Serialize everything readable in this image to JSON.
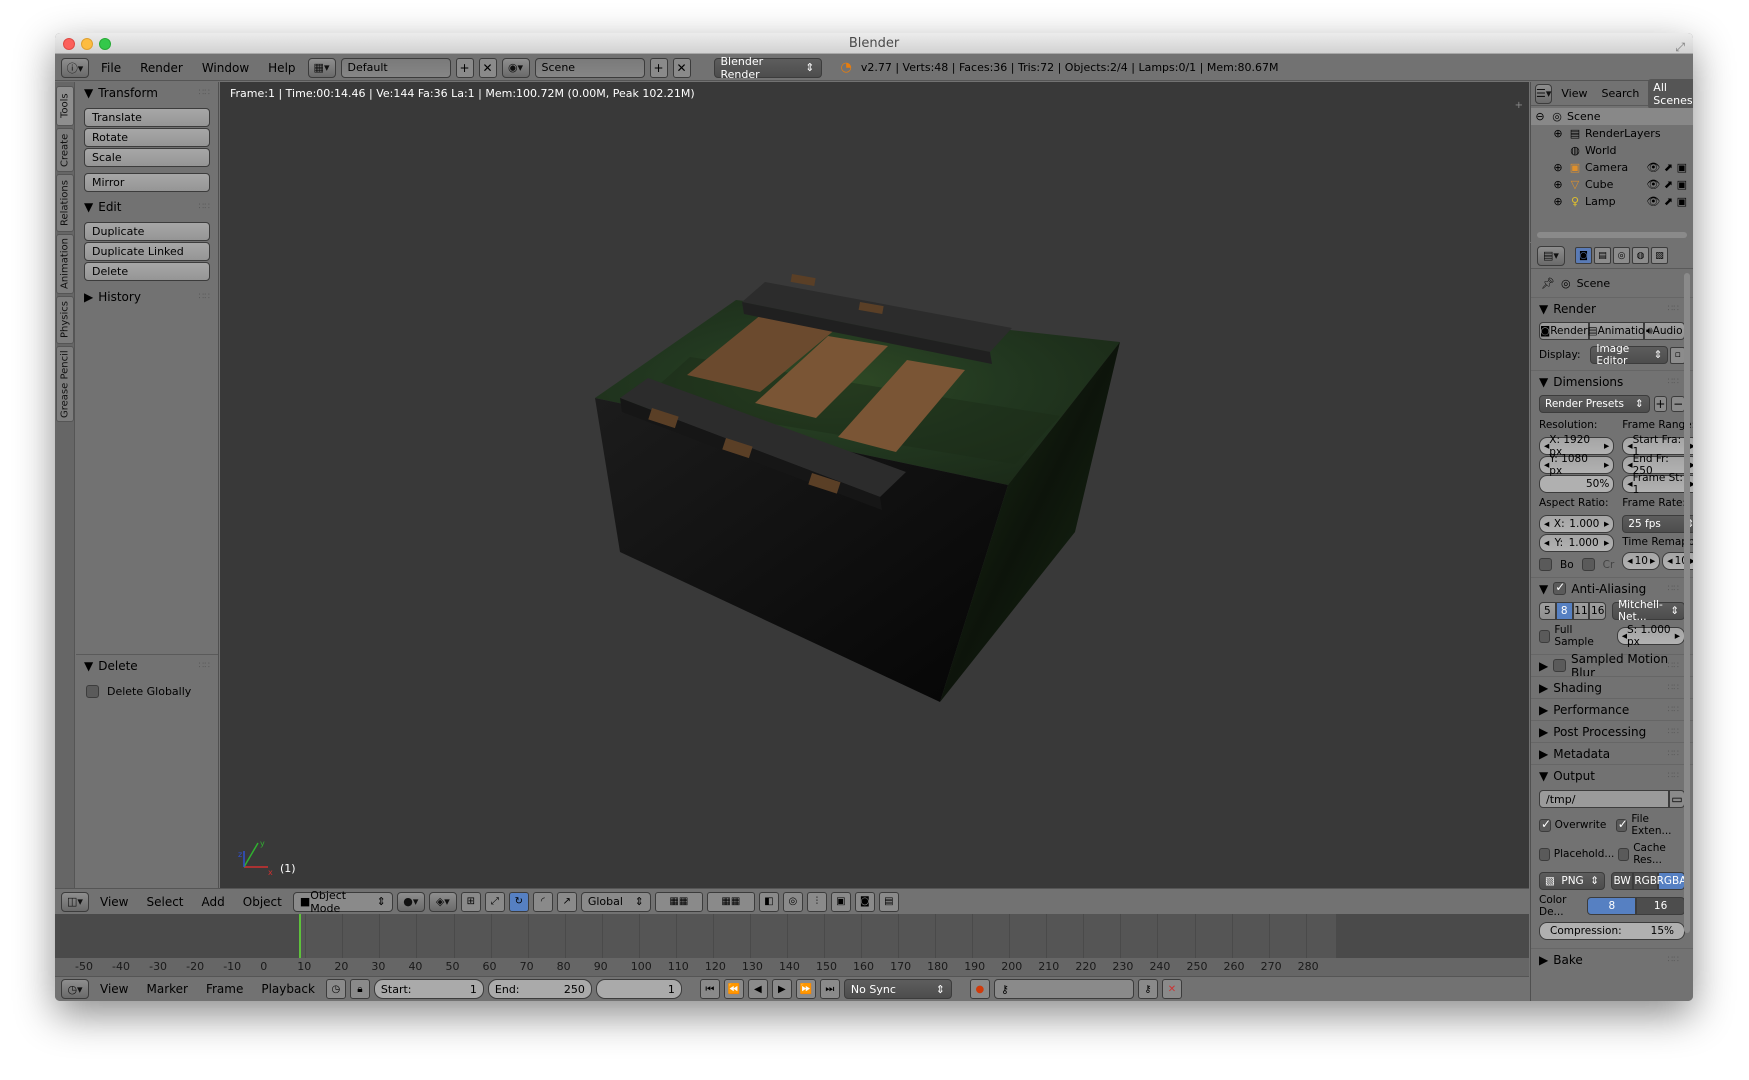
{
  "window": {
    "title": "Blender"
  },
  "infobar": {
    "menus": [
      "File",
      "Render",
      "Window",
      "Help"
    ],
    "layout": "Default",
    "scene": "Scene",
    "engine": "Blender Render",
    "stats": "v2.77 | Verts:48 | Faces:36 | Tris:72 | Objects:2/4 | Lamps:0/1 | Mem:80.67M"
  },
  "tabs": [
    "Tools",
    "Create",
    "Relations",
    "Animation",
    "Physics",
    "Grease Pencil"
  ],
  "toolshelf": {
    "transform": {
      "title": "Transform",
      "buttons": [
        "Translate",
        "Rotate",
        "Scale"
      ]
    },
    "mirror": "Mirror",
    "edit": {
      "title": "Edit",
      "buttons": [
        "Duplicate",
        "Duplicate Linked",
        "Delete"
      ]
    },
    "history": "History",
    "operator": {
      "title": "Delete",
      "option": "Delete Globally"
    }
  },
  "viewport": {
    "info": "Frame:1 | Time:00:14.46 | Ve:144 Fa:36 La:1 | Mem:100.72M (0.00M, Peak 102.21M)",
    "object_label": "(1)"
  },
  "view3d_header": {
    "menus": [
      "View",
      "Select",
      "Add",
      "Object"
    ],
    "mode": "Object Mode",
    "orientation": "Global"
  },
  "timeline": {
    "ticks": [
      "-50",
      "-40",
      "-30",
      "-20",
      "-10",
      "0",
      "10",
      "20",
      "30",
      "40",
      "50",
      "60",
      "70",
      "80",
      "90",
      "100",
      "110",
      "120",
      "130",
      "140",
      "150",
      "160",
      "170",
      "180",
      "190",
      "200",
      "210",
      "220",
      "230",
      "240",
      "250",
      "260",
      "270",
      "280"
    ],
    "menus": [
      "View",
      "Marker",
      "Frame",
      "Playback"
    ],
    "start_label": "Start:",
    "start": "1",
    "end_label": "End:",
    "end": "250",
    "current": "1",
    "sync": "No Sync"
  },
  "outliner": {
    "tabs": [
      "View",
      "Search",
      "All Scenes"
    ],
    "items": [
      {
        "label": "Scene",
        "icon": "scene-icon"
      },
      {
        "label": "RenderLayers",
        "icon": "renderlayers-icon"
      },
      {
        "label": "World",
        "icon": "world-icon"
      },
      {
        "label": "Camera",
        "icon": "camera-icon"
      },
      {
        "label": "Cube",
        "icon": "mesh-icon"
      },
      {
        "label": "Lamp",
        "icon": "lamp-icon"
      }
    ]
  },
  "properties": {
    "context": "Scene",
    "render": {
      "title": "Render",
      "buttons": [
        "Render",
        "Animatio",
        "Audio"
      ],
      "display_label": "Display:",
      "display": "Image Editor"
    },
    "dimensions": {
      "title": "Dimensions",
      "presets": "Render Presets",
      "resolution_label": "Resolution:",
      "res_x": "X: 1920 px",
      "res_y": "Y: 1080 px",
      "res_pct": "50%",
      "frame_range_label": "Frame Range:",
      "start": "Start Fra: 1",
      "end": "End Fr: 250",
      "step": "Frame St: 1",
      "aspect_label": "Aspect Ratio:",
      "asp_x": "X:",
      "asp_x_val": "1.000",
      "asp_y": "Y:",
      "asp_y_val": "1.000",
      "frame_rate_label": "Frame Rate:",
      "fps": "25 fps",
      "time_remap": "Time Remappi...",
      "border": "Bo",
      "crop": "Cr",
      "remap_old": "10",
      "remap_new": "10"
    },
    "antialiasing": {
      "title": "Anti-Aliasing",
      "samples": [
        "5",
        "8",
        "11",
        "16"
      ],
      "filter": "Mitchell-Net...",
      "full_sample": "Full Sample",
      "size": "S: 1.000 px"
    },
    "collapsed": [
      "Sampled Motion Blur",
      "Shading",
      "Performance",
      "Post Processing",
      "Metadata"
    ],
    "output": {
      "title": "Output",
      "path": "/tmp/",
      "overwrite": "Overwrite",
      "file_ext": "File Exten...",
      "placeholders": "Placehold...",
      "cache": "Cache Res...",
      "format": "PNG",
      "color_modes": [
        "BW",
        "RGB",
        "RGBA"
      ],
      "depth_label": "Color De...",
      "depths": [
        "8",
        "16"
      ],
      "compression": "Compression:",
      "compression_val": "15%"
    },
    "bake": "Bake"
  }
}
